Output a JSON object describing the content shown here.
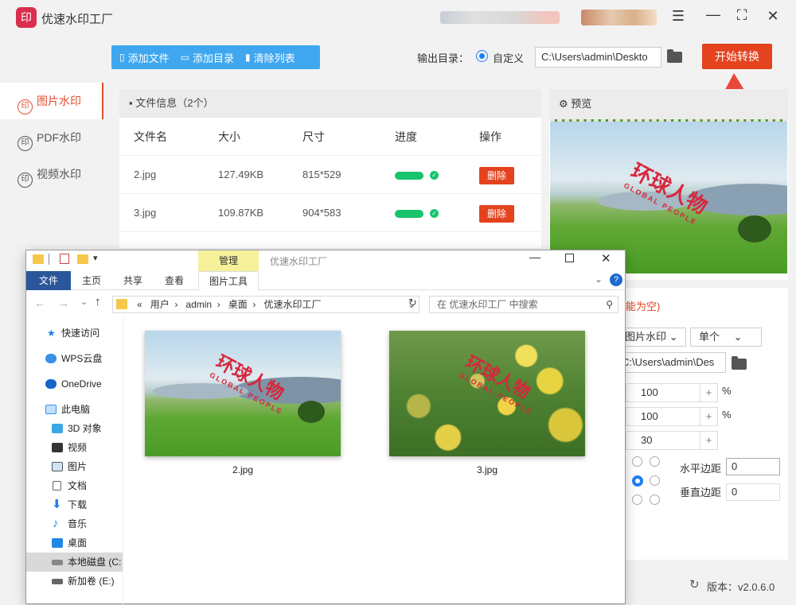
{
  "app": {
    "title": "优速水印工厂",
    "logo_glyph": "印"
  },
  "window_controls": {
    "menu": "☰",
    "minimize": "—",
    "maximize": "⛶",
    "close": "✕"
  },
  "sidebar": {
    "items": [
      {
        "label": "图片水印",
        "icon": "印",
        "active": true
      },
      {
        "label": "PDF水印",
        "icon": "印",
        "active": false
      },
      {
        "label": "视频水印",
        "icon": "印",
        "active": false
      }
    ]
  },
  "toolbar": {
    "add_file": "添加文件",
    "add_dir": "添加目录",
    "clear_list": "清除列表"
  },
  "output": {
    "label": "输出目录：",
    "radio_label": "自定义",
    "path": "C:\\Users\\admin\\Deskto"
  },
  "start_button": "开始转换",
  "file_panel": {
    "title": "文件信息（2个）",
    "columns": [
      "文件名",
      "大小",
      "尺寸",
      "进度",
      "操作"
    ],
    "rows": [
      {
        "name": "2.jpg",
        "size": "127.49KB",
        "dims": "815*529",
        "progress": 1.0,
        "action": "删除"
      },
      {
        "name": "3.jpg",
        "size": "109.87KB",
        "dims": "904*583",
        "progress": 1.0,
        "action": "删除"
      }
    ]
  },
  "preview": {
    "title": "预览",
    "watermark_text": "环球人物",
    "watermark_sub": "GLOBAL PEOPLE"
  },
  "settings": {
    "warning_fragment": "能为空)",
    "type_select": "图片水印",
    "mode_select": "单个",
    "path": "C:\\Users\\admin\\Des",
    "spin1": "100",
    "spin2": "100",
    "spin3": "30",
    "unit": "%",
    "h_margin_label": "水平边距",
    "h_margin": "0",
    "v_margin_label": "垂直边距",
    "v_margin": "0"
  },
  "version": "版本：v2.0.6.0",
  "explorer": {
    "title": "优速水印工厂",
    "manage_tab": "管理",
    "ribbon_tabs": [
      "文件",
      "主页",
      "共享",
      "查看",
      "图片工具"
    ],
    "address": [
      "用户",
      "admin",
      "桌面",
      "优速水印工厂"
    ],
    "address_prefix": "«",
    "search_placeholder": "在 优速水印工厂 中搜索",
    "nav": [
      {
        "label": "快速访问"
      },
      {
        "label": "WPS云盘"
      },
      {
        "label": "OneDrive"
      },
      {
        "label": "此电脑"
      },
      {
        "label": "3D 对象"
      },
      {
        "label": "视频"
      },
      {
        "label": "图片"
      },
      {
        "label": "文档"
      },
      {
        "label": "下载"
      },
      {
        "label": "音乐"
      },
      {
        "label": "桌面"
      },
      {
        "label": "本地磁盘 (C:"
      },
      {
        "label": "新加卷 (E:)"
      }
    ],
    "files": [
      {
        "name": "2.jpg"
      },
      {
        "name": "3.jpg"
      }
    ]
  }
}
